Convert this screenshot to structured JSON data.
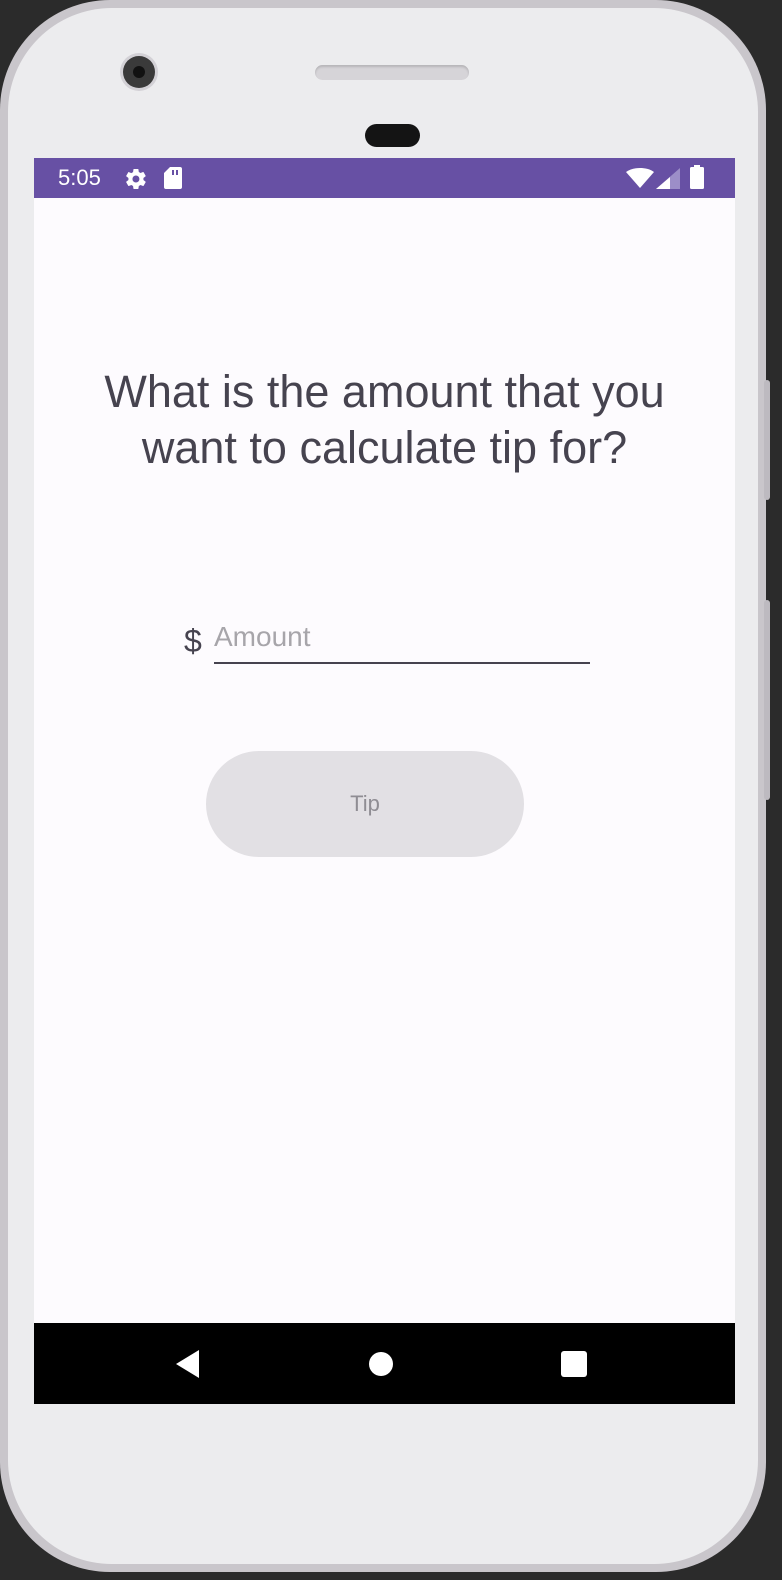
{
  "status_bar": {
    "time": "5:05",
    "background": "#6750a4",
    "icons_left": [
      "gear-icon",
      "sd-card-icon"
    ],
    "icons_right": [
      "wifi-icon",
      "cellular-signal-icon",
      "battery-icon"
    ]
  },
  "main": {
    "prompt": "What is the amount that you want to calculate tip for?",
    "currency_symbol": "$",
    "amount_input": {
      "value": "",
      "placeholder": "Amount"
    },
    "tip_button_label": "Tip"
  },
  "nav_bar": {
    "buttons": [
      "back-icon",
      "home-icon",
      "recents-icon"
    ]
  }
}
